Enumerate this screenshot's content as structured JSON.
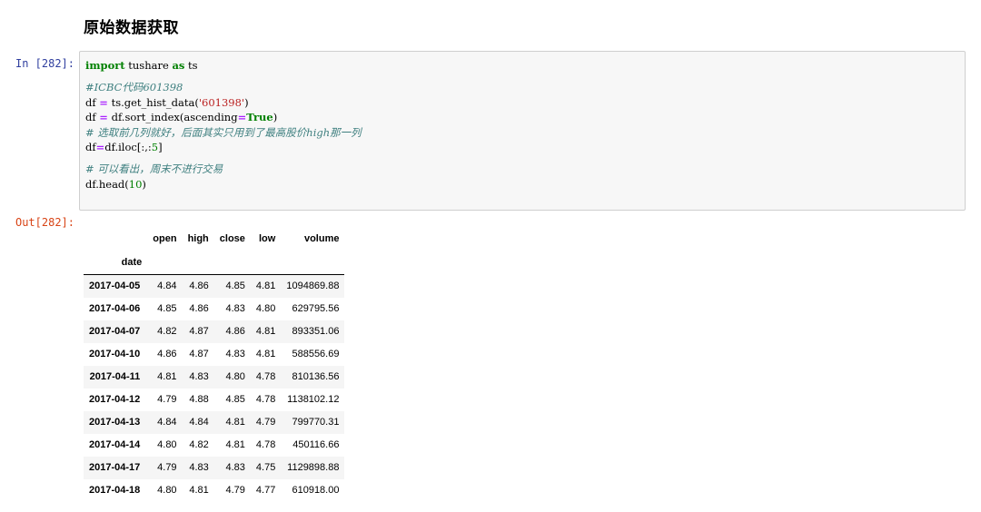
{
  "section": {
    "heading": "原始数据获取"
  },
  "input_prompt": "In [282]:",
  "output_prompt": "Out[282]:",
  "code": {
    "line1_kw_import": "import",
    "line1_mod": " tushare ",
    "line1_kw_as": "as",
    "line1_alias": " ts",
    "line2_comment": "#ICBC代码601398",
    "line3_a": "df ",
    "line3_eq": "=",
    "line3_b": " ts.get_hist_data(",
    "line3_str": "'601398'",
    "line3_c": ")",
    "line4_a": "df ",
    "line4_eq": "=",
    "line4_b": " df.sort_index(ascending",
    "line4_eq2": "=",
    "line4_true": "True",
    "line4_c": ")",
    "line5_comment": "# 选取前几列就好，后面其实只用到了最高股价high那一列",
    "line6_a": "df",
    "line6_eq": "=",
    "line6_b": "df.iloc[:,:",
    "line6_num": "5",
    "line6_c": "]",
    "line7_comment": "# 可以看出，周末不进行交易",
    "line8_a": "df.head(",
    "line8_num": "10",
    "line8_b": ")"
  },
  "dataframe": {
    "columns": [
      "open",
      "high",
      "close",
      "low",
      "volume"
    ],
    "index_name": "date",
    "rows": [
      {
        "date": "2017-04-05",
        "open": "4.84",
        "high": "4.86",
        "close": "4.85",
        "low": "4.81",
        "volume": "1094869.88"
      },
      {
        "date": "2017-04-06",
        "open": "4.85",
        "high": "4.86",
        "close": "4.83",
        "low": "4.80",
        "volume": "629795.56"
      },
      {
        "date": "2017-04-07",
        "open": "4.82",
        "high": "4.87",
        "close": "4.86",
        "low": "4.81",
        "volume": "893351.06"
      },
      {
        "date": "2017-04-10",
        "open": "4.86",
        "high": "4.87",
        "close": "4.83",
        "low": "4.81",
        "volume": "588556.69"
      },
      {
        "date": "2017-04-11",
        "open": "4.81",
        "high": "4.83",
        "close": "4.80",
        "low": "4.78",
        "volume": "810136.56"
      },
      {
        "date": "2017-04-12",
        "open": "4.79",
        "high": "4.88",
        "close": "4.85",
        "low": "4.78",
        "volume": "1138102.12"
      },
      {
        "date": "2017-04-13",
        "open": "4.84",
        "high": "4.84",
        "close": "4.81",
        "low": "4.79",
        "volume": "799770.31"
      },
      {
        "date": "2017-04-14",
        "open": "4.80",
        "high": "4.82",
        "close": "4.81",
        "low": "4.78",
        "volume": "450116.66"
      },
      {
        "date": "2017-04-17",
        "open": "4.79",
        "high": "4.83",
        "close": "4.83",
        "low": "4.75",
        "volume": "1129898.88"
      },
      {
        "date": "2017-04-18",
        "open": "4.80",
        "high": "4.81",
        "close": "4.79",
        "low": "4.77",
        "volume": "610918.00"
      }
    ]
  },
  "colors": {
    "in_prompt": "#303f9f",
    "out_prompt": "#d84315",
    "keyword": "#008000",
    "comment": "#408080",
    "string": "#ba2121",
    "cell_bg": "#f7f7f7"
  }
}
